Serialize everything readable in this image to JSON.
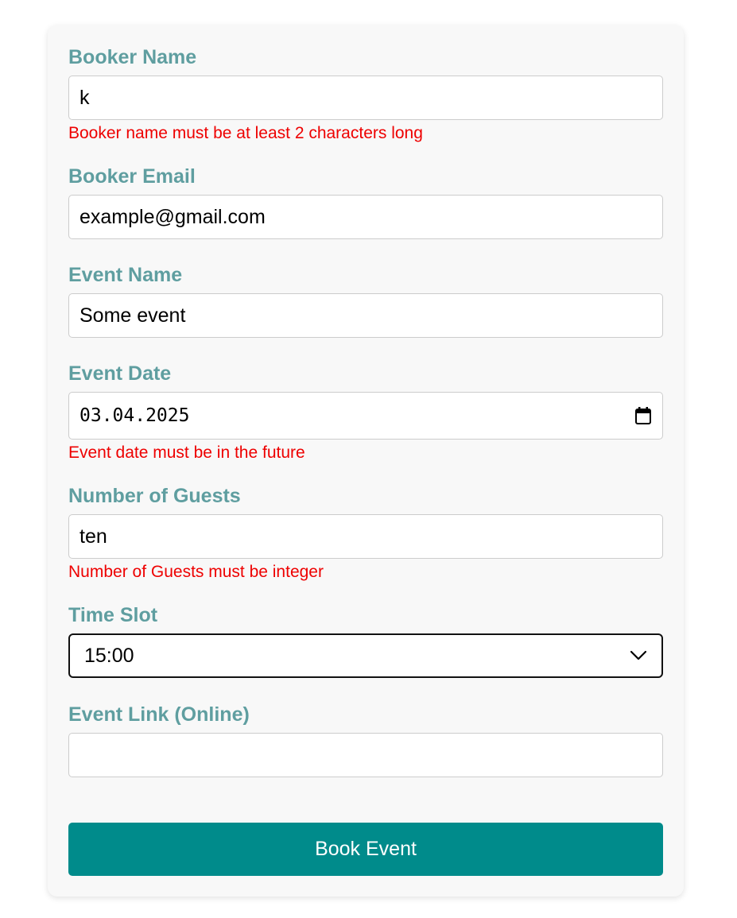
{
  "form": {
    "booker_name": {
      "label": "Booker Name",
      "value": "k",
      "error": "Booker name must be at least 2 characters long"
    },
    "booker_email": {
      "label": "Booker Email",
      "value": "example@gmail.com"
    },
    "event_name": {
      "label": "Event Name",
      "value": "Some event"
    },
    "event_date": {
      "label": "Event Date",
      "value": "03.04.2025",
      "error": "Event date must be in the future",
      "icon": "calendar-icon"
    },
    "number_of_guests": {
      "label": "Number of Guests",
      "value": "ten",
      "error": "Number of Guests must be integer"
    },
    "time_slot": {
      "label": "Time Slot",
      "selected": "15:00",
      "icon": "chevron-down-icon"
    },
    "event_link": {
      "label": "Event Link (Online)",
      "value": ""
    },
    "submit_label": "Book Event"
  },
  "colors": {
    "label": "#5f9ea0",
    "error": "#ee0000",
    "button": "#008b8b",
    "card_background": "#f8f8f8"
  }
}
